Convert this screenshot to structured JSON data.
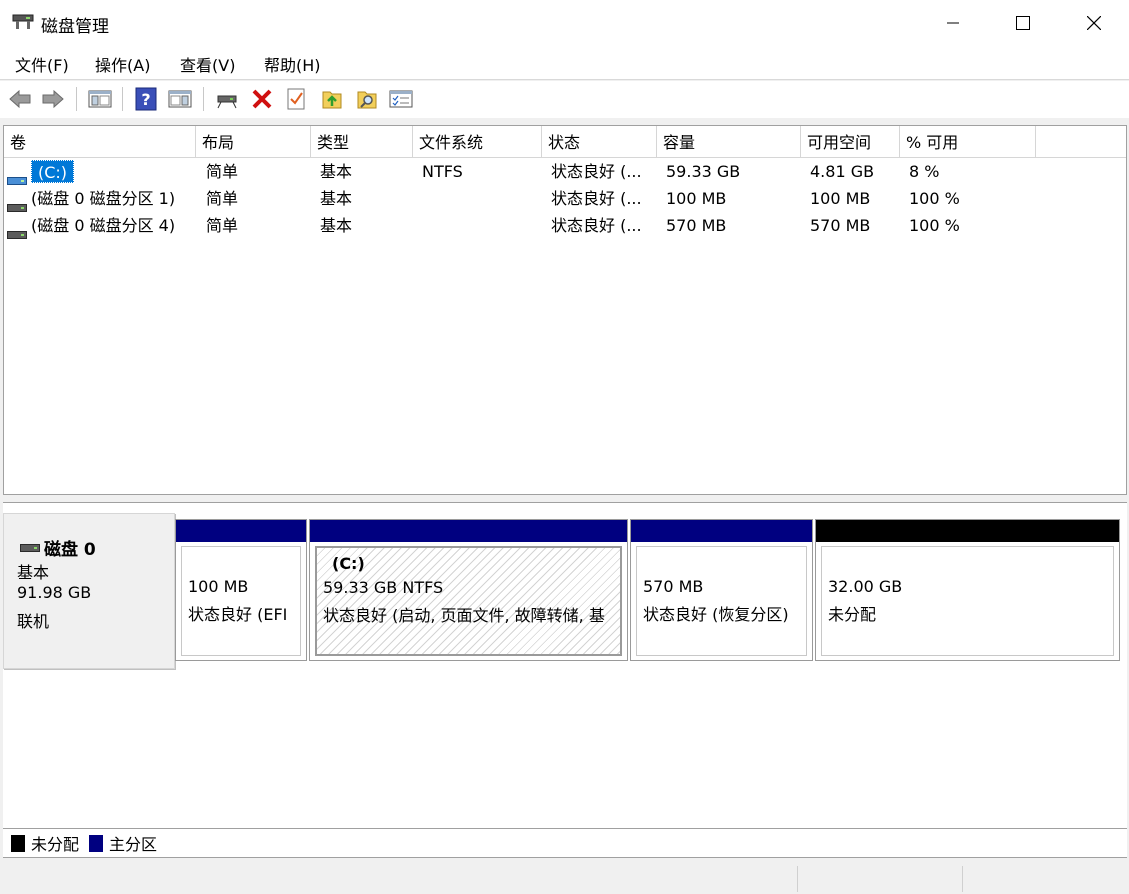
{
  "window": {
    "title": "磁盘管理"
  },
  "menu": [
    "文件(F)",
    "操作(A)",
    "查看(V)",
    "帮助(H)"
  ],
  "toolbar": {
    "icons": [
      "back-arrow-icon",
      "forward-arrow-icon",
      "show-hide-console-tree-icon",
      "help-icon",
      "show-hide-action-pane-icon",
      "connect-disk-icon",
      "delete-icon",
      "checklist-icon",
      "export-list-icon",
      "search-folder-icon",
      "properties-icon"
    ]
  },
  "volumes": {
    "columns": [
      "卷",
      "布局",
      "类型",
      "文件系统",
      "状态",
      "容量",
      "可用空间",
      "% 可用"
    ],
    "rows": [
      {
        "name": "(C:)",
        "layout": "简单",
        "type": "基本",
        "fs": "NTFS",
        "status": "状态良好 (...",
        "capacity": "59.33 GB",
        "free": "4.81 GB",
        "pct": "8 %"
      },
      {
        "name": "(磁盘 0 磁盘分区 1)",
        "layout": "简单",
        "type": "基本",
        "fs": "",
        "status": "状态良好 (...",
        "capacity": "100 MB",
        "free": "100 MB",
        "pct": "100 %"
      },
      {
        "name": "(磁盘 0 磁盘分区 4)",
        "layout": "简单",
        "type": "基本",
        "fs": "",
        "status": "状态良好 (...",
        "capacity": "570 MB",
        "free": "570 MB",
        "pct": "100 %"
      }
    ]
  },
  "disk": {
    "name": "磁盘 0",
    "kind": "基本",
    "size": "91.98 GB",
    "state": "联机",
    "partitions": [
      {
        "label": "",
        "size": "100 MB",
        "status": "状态良好 (EFI",
        "kind": "primary"
      },
      {
        "label": "(C:)",
        "size": "59.33 GB NTFS",
        "status": "状态良好 (启动, 页面文件, 故障转储, 基",
        "kind": "primary"
      },
      {
        "label": "",
        "size": "570 MB",
        "status": "状态良好 (恢复分区)",
        "kind": "primary"
      },
      {
        "label": "",
        "size": "32.00 GB",
        "status": "未分配",
        "kind": "unallocated"
      }
    ]
  },
  "legend": [
    {
      "label": "未分配",
      "color": "#000000"
    },
    {
      "label": "主分区",
      "color": "#000080"
    }
  ]
}
